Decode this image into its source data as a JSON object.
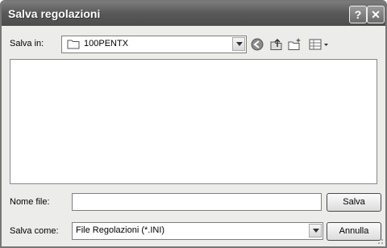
{
  "window": {
    "title": "Salva regolazioni"
  },
  "titlebar": {
    "help_glyph": "?",
    "close_glyph": "✕"
  },
  "lookin": {
    "label": "Salva in:",
    "value": "100PENTX"
  },
  "toolbar": {
    "icons": [
      "back-icon",
      "up-folder-icon",
      "new-folder-icon",
      "views-menu-icon"
    ]
  },
  "filename": {
    "label": "Nome file:",
    "value": ""
  },
  "filetype": {
    "label": "Salva come:",
    "value": "File Regolazioni (*.INI)"
  },
  "buttons": {
    "save": "Salva",
    "cancel": "Annulla"
  }
}
